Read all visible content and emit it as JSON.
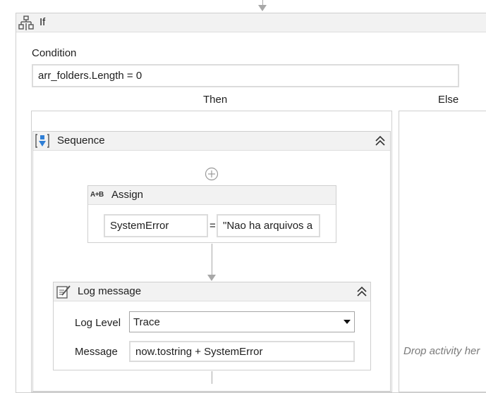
{
  "if_activity": {
    "title": "If",
    "condition_label": "Condition",
    "condition_value": "arr_folders.Length = 0",
    "then_label": "Then",
    "else_label": "Else",
    "else_drop_hint": "Drop activity her"
  },
  "sequence": {
    "title": "Sequence"
  },
  "assign": {
    "title": "Assign",
    "icon_text": "A+B",
    "to_value": "SystemError",
    "equals": "=",
    "value": "\"Nao ha arquivos a"
  },
  "log_message": {
    "title": "Log message",
    "log_level_label": "Log Level",
    "log_level_value": "Trace",
    "message_label": "Message",
    "message_value": "now.tostring + SystemError"
  }
}
